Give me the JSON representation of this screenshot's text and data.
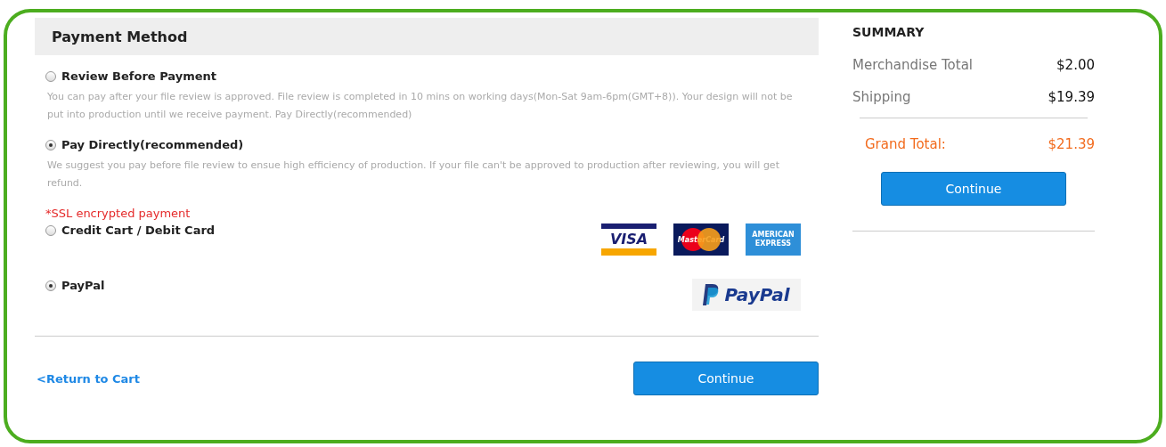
{
  "payment_method": {
    "title": "Payment Method",
    "timing_options": [
      {
        "label": "Review Before Payment",
        "selected": false,
        "description": "You can pay after your file review is approved. File review is completed in 10 mins on working days(Mon-Sat 9am-6pm(GMT+8)). Your design will not be put into production until we receive payment. Pay Directly(recommended)"
      },
      {
        "label": "Pay Directly(recommended)",
        "selected": true,
        "description": "We suggest you pay before file review to ensue high efficiency of production. If your file can't be approved to production after reviewing, you will get refund."
      }
    ],
    "ssl_note": "*SSL encrypted payment",
    "methods": [
      {
        "label": "Credit Cart / Debit Card",
        "selected": false,
        "logos": [
          {
            "kind": "visa",
            "text": "VISA"
          },
          {
            "kind": "mastercard",
            "text": "MasterCard"
          },
          {
            "kind": "amex",
            "text": "AMERICAN EXPRESS"
          }
        ]
      },
      {
        "label": "PayPal",
        "selected": true,
        "logos": [
          {
            "kind": "paypal",
            "text": "PayPal"
          }
        ]
      }
    ],
    "return_link": "<Return to Cart",
    "continue_button": "Continue"
  },
  "summary": {
    "title": "SUMMARY",
    "rows": [
      {
        "label": "Merchandise Total",
        "value": "$2.00"
      },
      {
        "label": "Shipping",
        "value": "$19.39"
      }
    ],
    "grand_total": {
      "label": "Grand Total:",
      "value": "$21.39"
    },
    "continue_button": "Continue"
  }
}
